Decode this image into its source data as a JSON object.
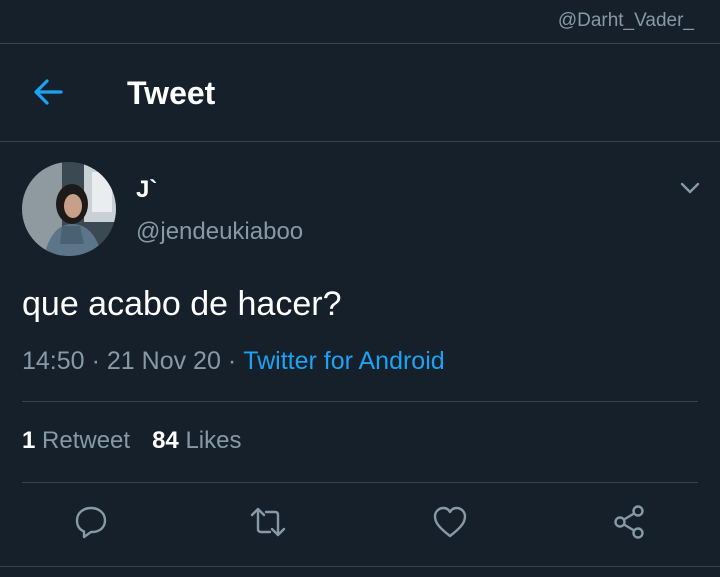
{
  "watermark": "@Darht_Vader_",
  "header": {
    "title": "Tweet",
    "back_icon": "arrow-left-icon"
  },
  "tweet": {
    "display_name": "J`",
    "handle": "@jendeukiaboo",
    "text": "que acabo de hacer?",
    "time": "14:50",
    "separator": "·",
    "date": "21 Nov 20",
    "client": "Twitter for Android",
    "retweet_count": "1",
    "retweet_label": "Retweet",
    "like_count": "84",
    "like_label": "Likes"
  },
  "actions": [
    "reply-icon",
    "retweet-icon",
    "like-icon",
    "share-icon"
  ],
  "colors": {
    "background": "#15202b",
    "accent": "#1da1f2",
    "secondary_text": "#8899a6",
    "divider": "#38444d"
  }
}
